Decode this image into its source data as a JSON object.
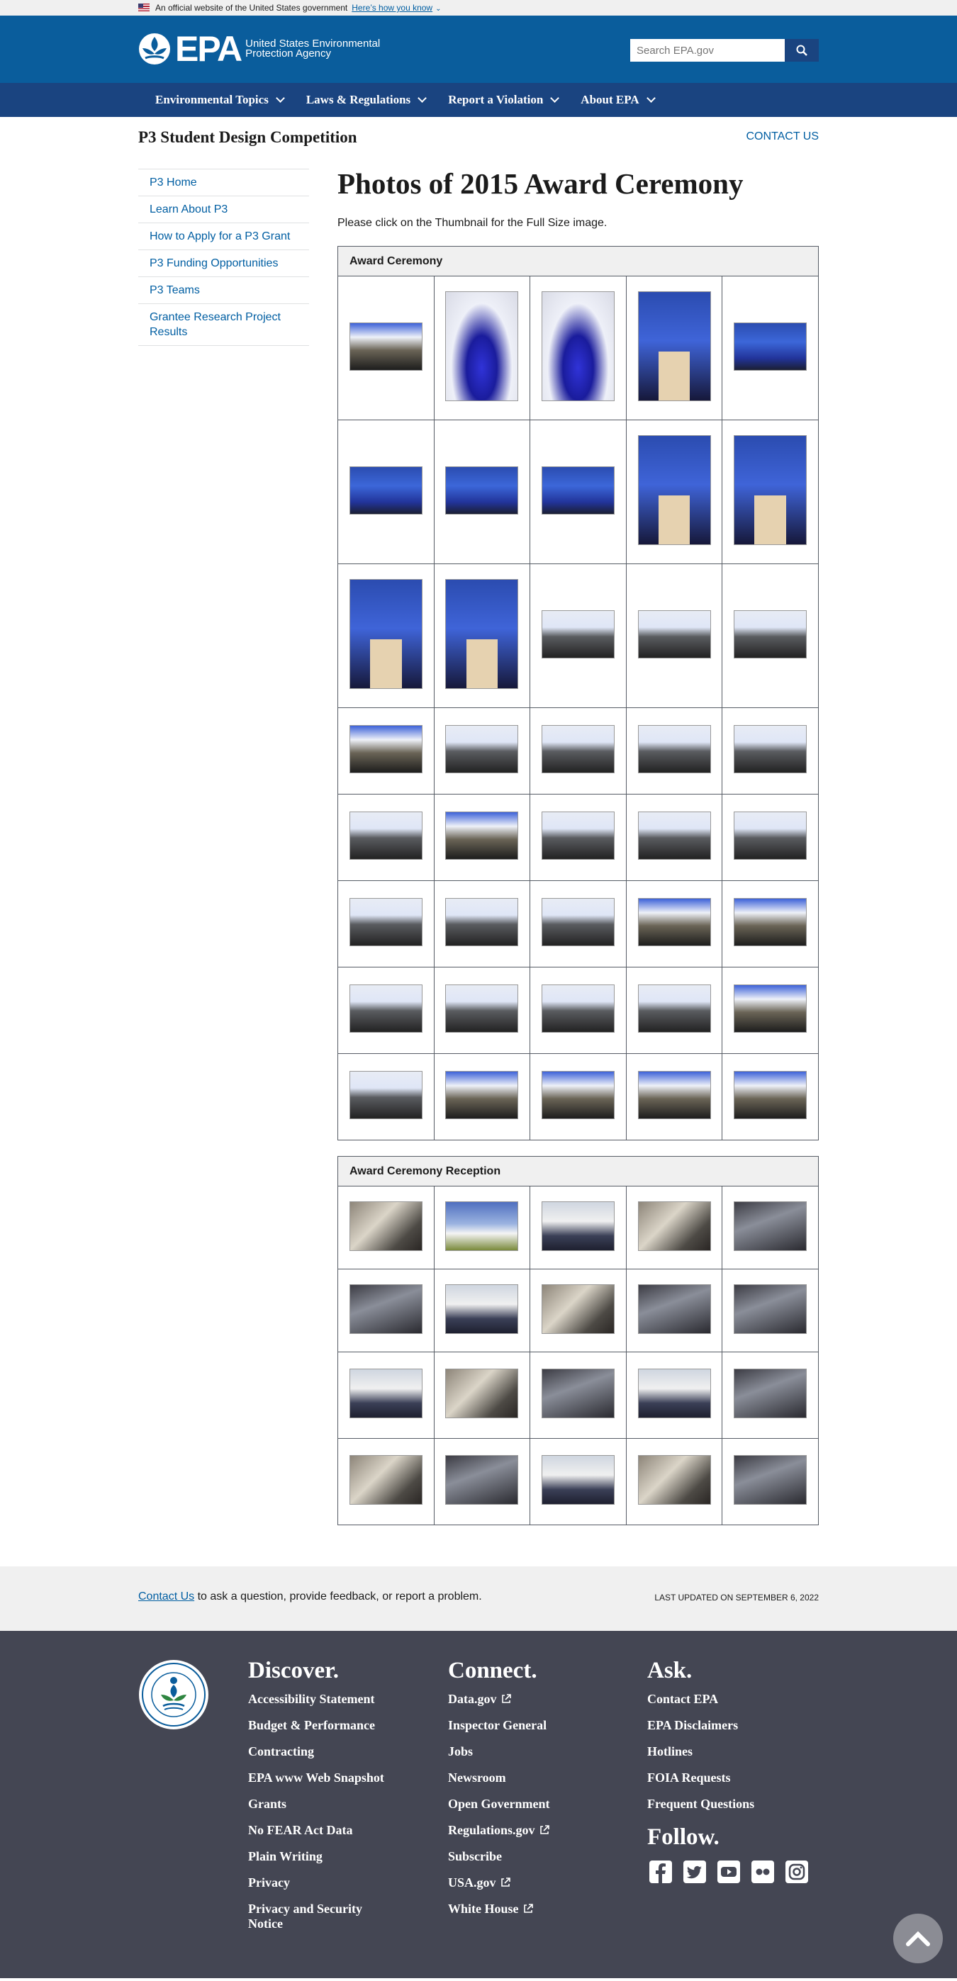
{
  "gov_banner": {
    "text": "An official website of the United States government",
    "how_link": "Here’s how you know"
  },
  "header": {
    "logo_word": "EPA",
    "agency": "United States Environmental Protection Agency",
    "search_placeholder": "Search EPA.gov"
  },
  "nav": [
    "Environmental Topics",
    "Laws & Regulations",
    "Report a Violation",
    "About EPA"
  ],
  "subhead": {
    "title": "P3 Student Design Competition",
    "contact": "CONTACT US"
  },
  "sidenav": [
    "P3 Home",
    "Learn About P3",
    "How to Apply for a P3 Grant",
    "P3 Funding Opportunities",
    "P3 Teams",
    "Grantee Research Project Results"
  ],
  "main": {
    "title": "Photos of 2015 Award Ceremony",
    "intro": "Please click on the Thumbnail for the Full Size image."
  },
  "galleries": [
    {
      "heading": "Award Ceremony"
    },
    {
      "heading": "Award Ceremony Reception"
    }
  ],
  "footer_contact": {
    "link": "Contact Us",
    "text": " to ask a question, provide feedback, or report a problem.",
    "updated": "LAST UPDATED ON SEPTEMBER 6, 2022"
  },
  "footer": {
    "discover": {
      "heading": "Discover.",
      "links": [
        "Accessibility Statement",
        "Budget & Performance",
        "Contracting",
        "EPA www Web Snapshot",
        "Grants",
        "No FEAR Act Data",
        "Plain Writing",
        "Privacy",
        "Privacy and Security Notice"
      ]
    },
    "connect": {
      "heading": "Connect.",
      "links": [
        "Data.gov",
        "Inspector General",
        "Jobs",
        "Newsroom",
        "Open Government",
        "Regulations.gov",
        "Subscribe",
        "USA.gov",
        "White House"
      ]
    },
    "ask": {
      "heading": "Ask.",
      "links": [
        "Contact EPA",
        "EPA Disclaimers",
        "Hotlines",
        "FOIA Requests",
        "Frequent Questions"
      ]
    },
    "follow": {
      "heading": "Follow.",
      "icons": [
        "facebook-icon",
        "twitter-icon",
        "youtube-icon",
        "flickr-icon",
        "instagram-icon"
      ]
    }
  }
}
